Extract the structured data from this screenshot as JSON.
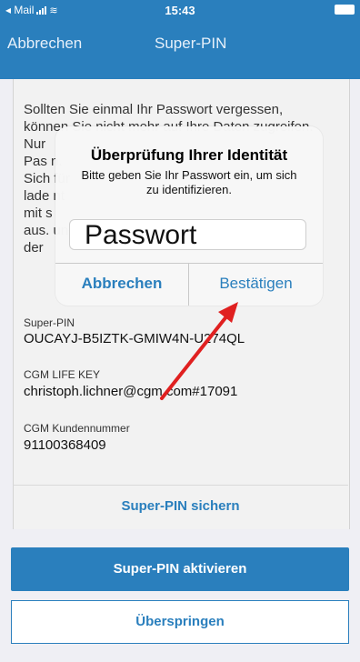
{
  "status_bar": {
    "carrier": "◂ Mail",
    "time": "15:43"
  },
  "nav": {
    "cancel_label": "Abbrechen",
    "title": "Super-PIN"
  },
  "intro_text": "Sollten Sie einmal Ihr Passwort vergessen,\nkönnen Sie nicht mehr auf Ihre Daten zugreifen.\nNur                                                    \nPas                                                   n.\nSich                                                  für\nlade                                                  nt\nmit                                                    s\naus.                                                  ung\nder",
  "fields": {
    "super_pin_label": "Super-PIN",
    "super_pin_value": "OUCAYJ-B5IZTK-GMIW4N-U274QL",
    "life_key_label": "CGM LIFE KEY",
    "life_key_value": "christoph.lichner@cgm.com#17091",
    "customer_no_label": "CGM Kundennummer",
    "customer_no_value": "91100368409"
  },
  "buttons": {
    "save_label": "Super-PIN sichern",
    "activate_label": "Super-PIN aktivieren",
    "skip_label": "Überspringen"
  },
  "dialog": {
    "title": "Überprüfung Ihrer Identität",
    "message": "Bitte geben Sie Ihr Passwort ein, um sich zu identifizieren.",
    "input_placeholder": "Passwort",
    "cancel_label": "Abbrechen",
    "confirm_label": "Bestätigen"
  },
  "colors": {
    "accent": "#2a7fbd",
    "annotation_arrow": "#e02020"
  }
}
